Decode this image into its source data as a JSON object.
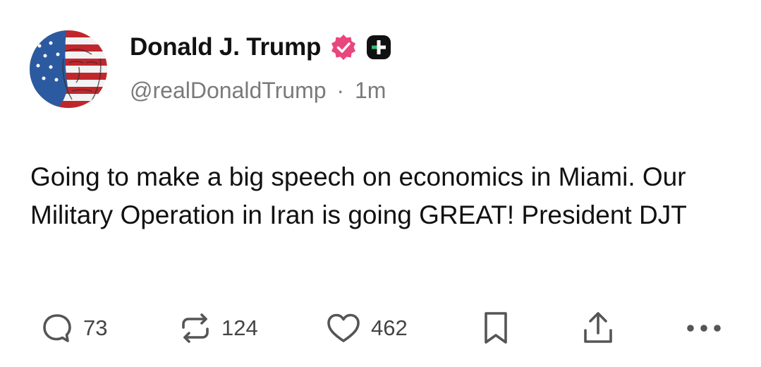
{
  "post": {
    "author_name": "Donald J. Trump",
    "handle": "@realDonaldTrump",
    "separator": "·",
    "time": "1m",
    "text": "Going to make a big speech on economics in Miami. Our Military Operation in Iran is going GREAT! President DJT"
  },
  "badges": {
    "verified_icon": "verified-badge-icon",
    "verified_color": "#e8467c",
    "plus_icon": "plus-badge-icon"
  },
  "actions": {
    "reply_count": "73",
    "repost_count": "124",
    "like_count": "462",
    "icons": [
      "reply-icon",
      "repost-icon",
      "like-icon",
      "bookmark-icon",
      "share-icon",
      "more-icon"
    ]
  }
}
